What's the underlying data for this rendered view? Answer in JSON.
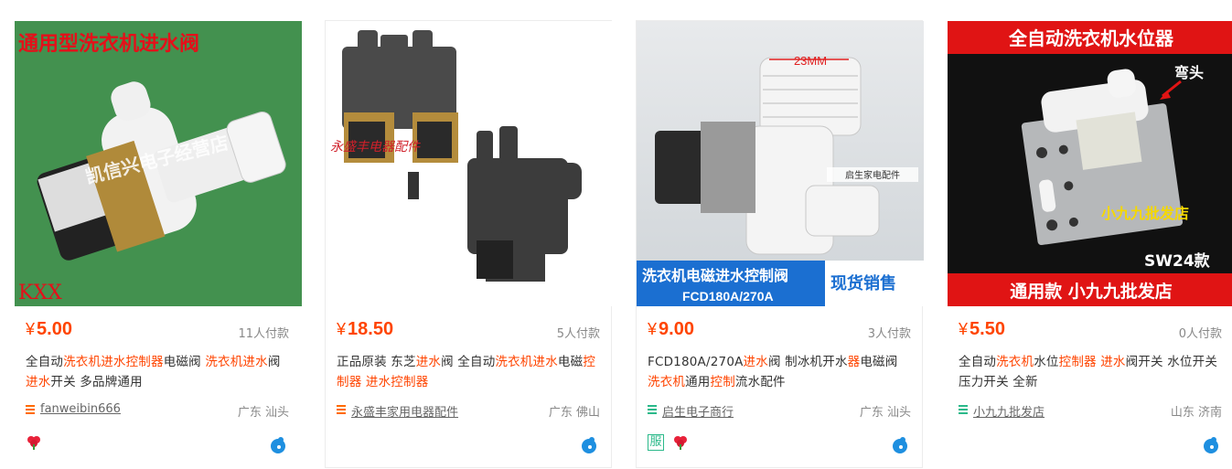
{
  "colors": {
    "price": "#ff4400",
    "highlight": "#ff4400",
    "shop_icon_orange": "#ff6a00",
    "shop_icon_green": "#2bb98a"
  },
  "products": [
    {
      "image_caption": "通用型洗衣机进水阀",
      "image_watermark": "凯信兴电子经营店",
      "image_corner": "KXX",
      "price": "5.00",
      "currency": "¥",
      "paid": "11人付款",
      "title_parts": [
        "全自动",
        "洗衣机进水控制器",
        "电磁阀 ",
        "洗衣机进",
        "水",
        "阀",
        "进水",
        "开关 多品牌通用"
      ],
      "shop": "fanweibin666",
      "location": "广东 汕头",
      "shop_icon": "shop-icon-orange",
      "badges": [
        "flower-badge-icon"
      ]
    },
    {
      "image_watermark": "永盛丰电器配件",
      "price": "18.50",
      "currency": "¥",
      "paid": "5人付款",
      "title_parts": [
        "正品原装 东芝",
        "进水",
        "阀 全自动",
        "洗衣机进水",
        "电磁",
        "控制器",
        " ",
        "进水控制器"
      ],
      "shop": "永盛丰家用电器配件",
      "location": "广东 佛山",
      "shop_icon": "shop-icon-orange",
      "badges": []
    },
    {
      "image_size_label": "23MM",
      "image_tag": "启生家电配件",
      "image_banner": "洗衣机电磁进水控制阀",
      "image_banner_model": "FCD180A/270A",
      "image_banner_right": "现货销售",
      "price": "9.00",
      "currency": "¥",
      "paid": "3人付款",
      "title_parts": [
        "FCD180A/270A",
        "进水",
        "阀 制冰机开水",
        "器",
        "电磁阀",
        "洗衣机",
        "通用",
        "控制",
        "流水配件"
      ],
      "shop": "启生电子商行",
      "location": "广东 汕头",
      "shop_icon": "shop-icon-green",
      "badges": [
        "clothing-badge-icon",
        "flower-badge-icon"
      ],
      "badge_text": "服"
    },
    {
      "image_top_banner": "全自动洗衣机水位器",
      "image_arrow_label": "弯头",
      "image_watermark": "小九九批发店",
      "image_model": "SW24款",
      "image_bottom_banner": "通用款 小九九批发店",
      "price": "5.50",
      "currency": "¥",
      "paid": "0人付款",
      "title_parts": [
        "全自动",
        "洗衣机",
        "水位",
        "控制器",
        " ",
        "进水",
        "阀开关 水位开关 压力开关 全新"
      ],
      "shop": "小九九批发店",
      "location": "山东 济南",
      "shop_icon": "shop-icon-green",
      "badges": []
    }
  ]
}
